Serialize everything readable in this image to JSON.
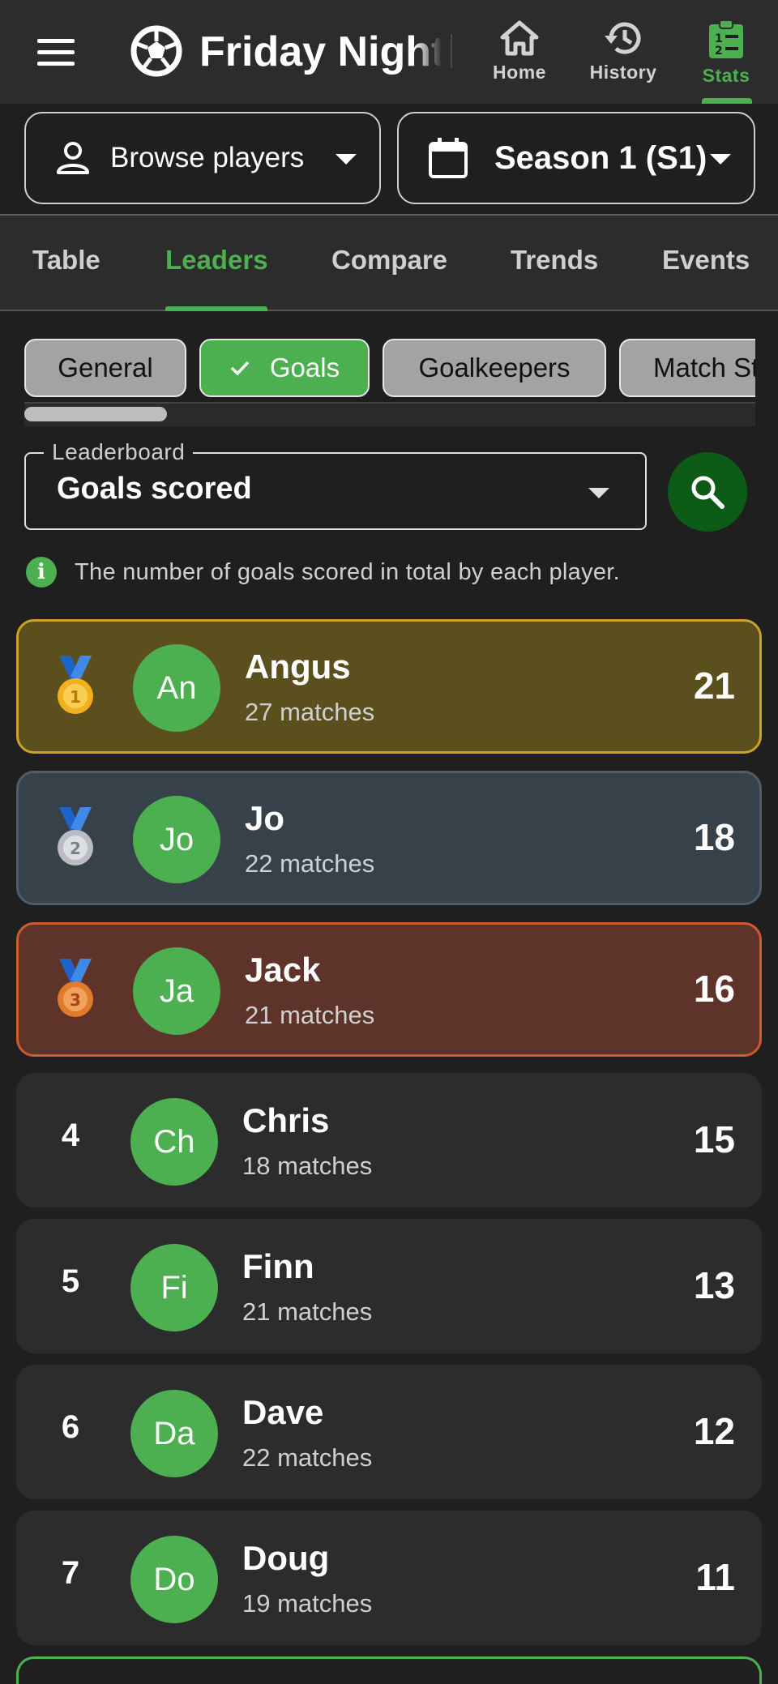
{
  "app": {
    "title": "Friday Night",
    "nav": [
      {
        "label": "Home",
        "icon": "home-icon"
      },
      {
        "label": "History",
        "icon": "history-icon"
      },
      {
        "label": "Stats",
        "icon": "stats-clipboard-icon",
        "active": true
      }
    ]
  },
  "selectors": {
    "players_label": "Browse players",
    "season_label": "Season 1 (S1)"
  },
  "tabs": [
    "Table",
    "Leaders",
    "Compare",
    "Trends",
    "Events"
  ],
  "active_tab": "Leaders",
  "chips": [
    "General",
    "Goals",
    "Goalkeepers",
    "Match St"
  ],
  "selected_chip": "Goals",
  "leaderboard": {
    "legend": "Leaderboard",
    "value": "Goals scored",
    "description": "The number of goals scored in total by each player."
  },
  "players": [
    {
      "rank": "1",
      "initials": "An",
      "name": "Angus",
      "matches": "27 matches",
      "value": "21"
    },
    {
      "rank": "2",
      "initials": "Jo",
      "name": "Jo",
      "matches": "22 matches",
      "value": "18"
    },
    {
      "rank": "3",
      "initials": "Ja",
      "name": "Jack",
      "matches": "21 matches",
      "value": "16"
    },
    {
      "rank": "4",
      "initials": "Ch",
      "name": "Chris",
      "matches": "18 matches",
      "value": "15"
    },
    {
      "rank": "5",
      "initials": "Fi",
      "name": "Finn",
      "matches": "21 matches",
      "value": "13"
    },
    {
      "rank": "6",
      "initials": "Da",
      "name": "Dave",
      "matches": "22 matches",
      "value": "12"
    },
    {
      "rank": "7",
      "initials": "Do",
      "name": "Doug",
      "matches": "19 matches",
      "value": "11"
    }
  ],
  "colors": {
    "accent": "#4caf50",
    "gold": "#c9a227",
    "silver": "#4e5d69",
    "bronze": "#d15a2b",
    "search_button": "#0c5b17"
  }
}
